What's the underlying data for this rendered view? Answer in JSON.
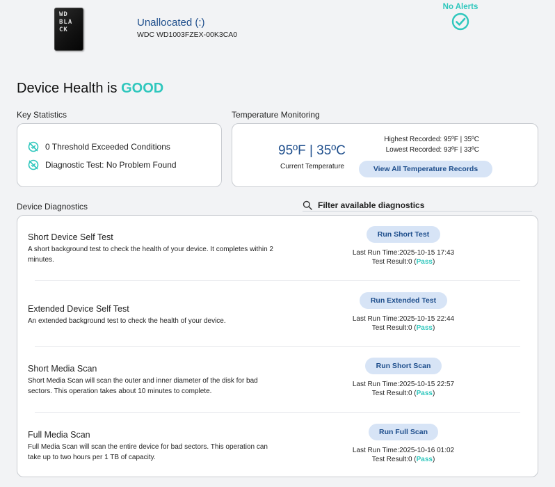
{
  "device": {
    "name": "Unallocated (:)",
    "model": "WDC WD1003FZEX-00K3CA0",
    "image_text": "WD BLACK"
  },
  "alerts": {
    "label": "No Alerts",
    "icon": "check-circle-icon"
  },
  "health": {
    "prefix": "Device Health is",
    "status": "GOOD",
    "status_color": "#2fc7bd"
  },
  "key_statistics": {
    "label": "Key Statistics",
    "items": [
      {
        "icon": "no-alert-icon",
        "text": "0 Threshold Exceeded Conditions"
      },
      {
        "icon": "no-alert-icon",
        "text": "Diagnostic Test: No Problem Found"
      }
    ]
  },
  "temperature": {
    "label": "Temperature Monitoring",
    "current": "95ºF | 35ºC",
    "current_caption": "Current Temperature",
    "highest": "Highest Recorded: 95ºF | 35ºC",
    "lowest": "Lowest Recorded: 93ºF | 33ºC",
    "view_all_button": "View All Temperature Records"
  },
  "diagnostics": {
    "label": "Device Diagnostics",
    "filter_placeholder": "Filter available diagnostics",
    "items": [
      {
        "title": "Short Device Self Test",
        "description": "A short background test to check the health of your device. It completes within 2 minutes.",
        "button": "Run Short Test",
        "last_run_label": "Last Run Time:",
        "last_run": "2025-10-15 17:43",
        "result_label": "Test Result:",
        "result_code": "0",
        "result_text": "Pass"
      },
      {
        "title": "Extended Device Self Test",
        "description": "An extended background test to check the health of your device.",
        "button": "Run Extended Test",
        "last_run_label": "Last Run Time:",
        "last_run": "2025-10-15 22:44",
        "result_label": "Test Result:",
        "result_code": "0",
        "result_text": "Pass"
      },
      {
        "title": "Short Media Scan",
        "description": "Short Media Scan will scan the outer and inner diameter of the disk for bad sectors. This operation takes about 10 minutes to complete.",
        "button": "Run Short Scan",
        "last_run_label": "Last Run Time:",
        "last_run": "2025-10-15 22:57",
        "result_label": "Test Result:",
        "result_code": "0",
        "result_text": "Pass"
      },
      {
        "title": "Full Media Scan",
        "description": "Full Media Scan will scan the entire device for bad sectors. This operation can take up to two hours per 1 TB of capacity.",
        "button": "Run Full Scan",
        "last_run_label": "Last Run Time:",
        "last_run": "2025-10-16 01:02",
        "result_label": "Test Result:",
        "result_code": "0",
        "result_text": "Pass"
      }
    ]
  },
  "colors": {
    "accent": "#2fc7bd",
    "link_blue": "#1e4e8c",
    "button_bg": "#d7e4f6",
    "page_bg": "#f2f3f5"
  }
}
